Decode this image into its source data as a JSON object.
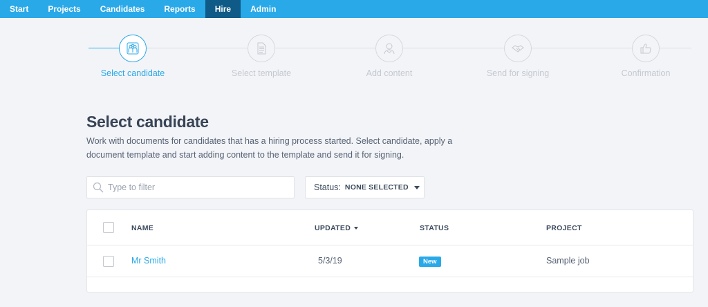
{
  "nav": {
    "items": [
      {
        "label": "Start"
      },
      {
        "label": "Projects"
      },
      {
        "label": "Candidates"
      },
      {
        "label": "Reports"
      },
      {
        "label": "Hire"
      },
      {
        "label": "Admin"
      }
    ],
    "active": "Hire"
  },
  "stepper": {
    "steps": [
      {
        "label": "Select candidate",
        "icon": "people-icon",
        "active": true
      },
      {
        "label": "Select template",
        "icon": "document-icon",
        "active": false
      },
      {
        "label": "Add content",
        "icon": "user-badge-icon",
        "active": false
      },
      {
        "label": "Send for signing",
        "icon": "handshake-icon",
        "active": false
      },
      {
        "label": "Confirmation",
        "icon": "thumbs-up-icon",
        "active": false
      }
    ]
  },
  "page": {
    "title": "Select candidate",
    "description": "Work with documents for candidates that has a hiring process started. Select candidate, apply a document template and start adding content to the template and send it for signing."
  },
  "filters": {
    "search_placeholder": "Type to filter",
    "status_label": "Status:",
    "status_value": "NONE SELECTED"
  },
  "table": {
    "headers": {
      "name": "NAME",
      "updated": "UPDATED",
      "status": "STATUS",
      "project": "PROJECT"
    },
    "rows": [
      {
        "name": "Mr Smith",
        "updated": "5/3/19",
        "status": "New",
        "project": "Sample job"
      }
    ]
  },
  "colors": {
    "accent": "#2aa9e8",
    "nav_active": "#0f5a86",
    "background": "#f3f4f7"
  }
}
